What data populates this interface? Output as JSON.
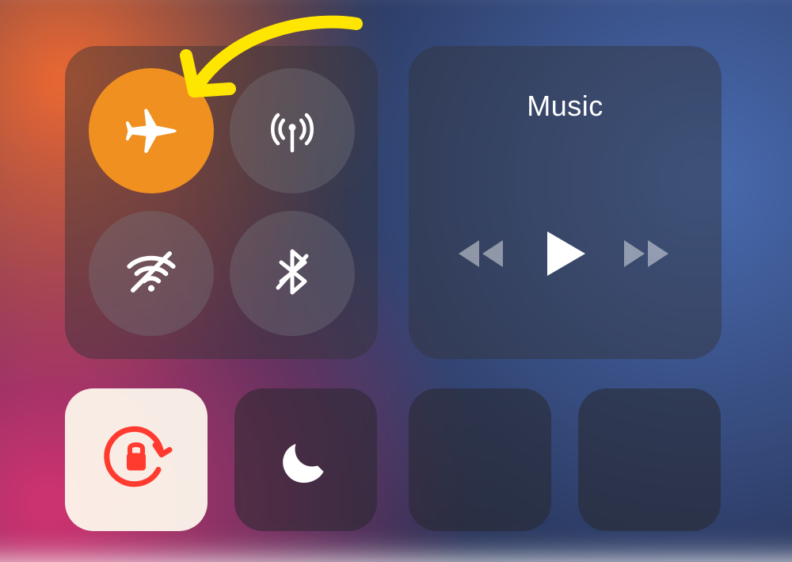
{
  "connectivity": {
    "airplane": {
      "name": "airplane-mode",
      "active": true
    },
    "cellular": {
      "name": "cellular-data",
      "active": false
    },
    "wifi": {
      "name": "wifi",
      "active": false
    },
    "bluetooth": {
      "name": "bluetooth",
      "active": false
    }
  },
  "media": {
    "now_playing_title": "Music",
    "rewind": "rewind",
    "play": "play",
    "forward": "forward"
  },
  "tiles": {
    "orientation_lock": {
      "name": "orientation-lock",
      "active": true
    },
    "do_not_disturb": {
      "name": "do-not-disturb",
      "active": false
    }
  },
  "annotation": {
    "arrow_points_to": "airplane-mode-button",
    "arrow_color": "#ffe600"
  }
}
